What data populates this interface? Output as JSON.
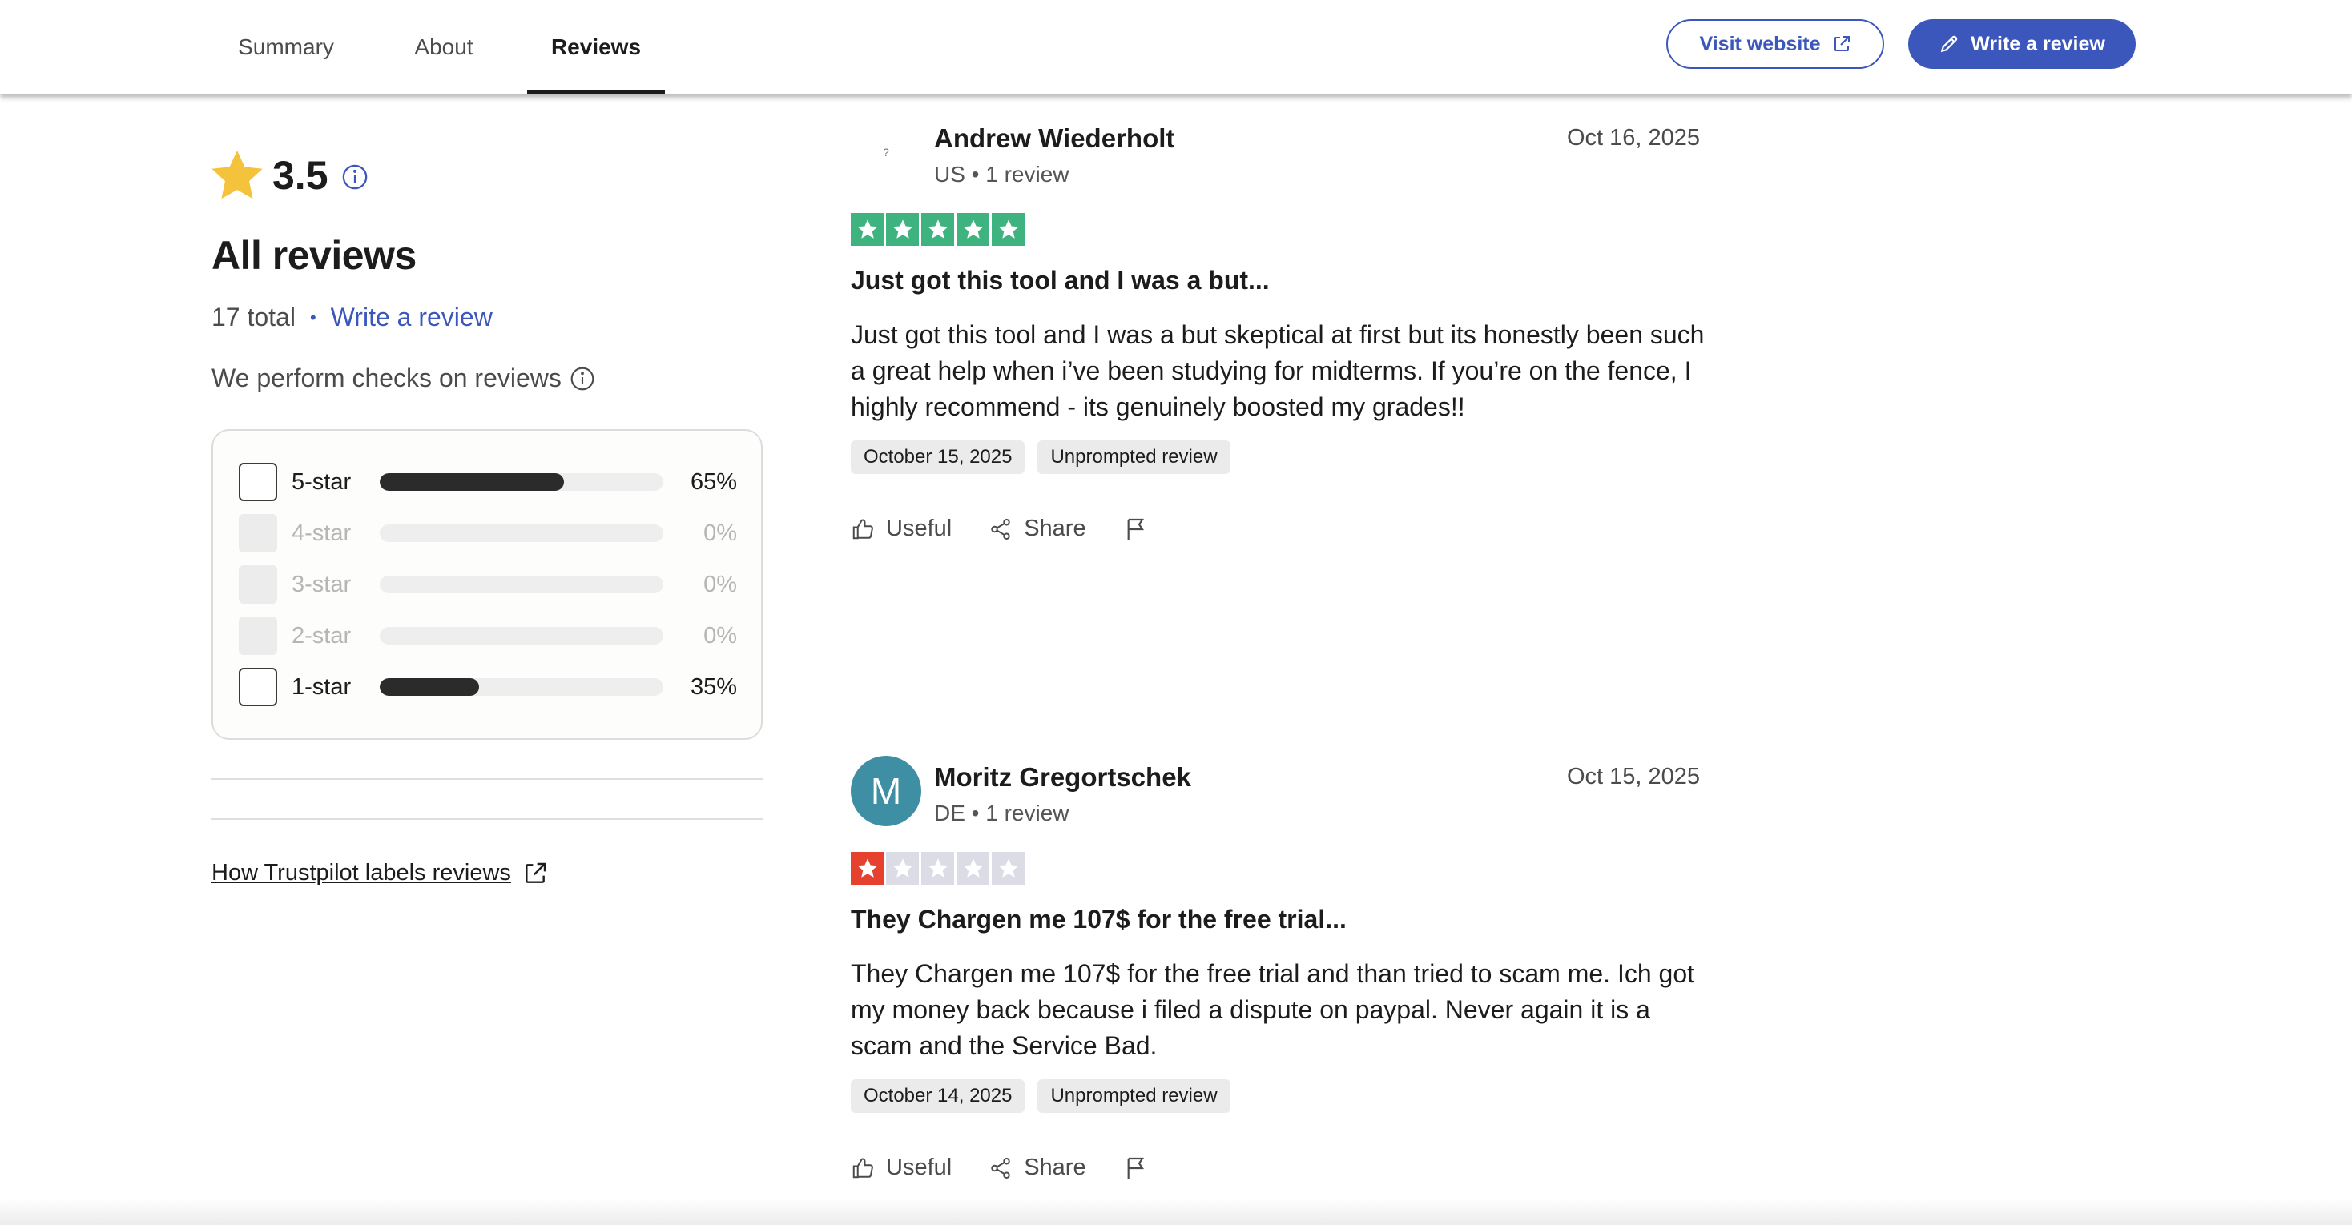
{
  "nav": {
    "tabs": [
      {
        "label": "Summary",
        "active": false
      },
      {
        "label": "About",
        "active": false
      },
      {
        "label": "Reviews",
        "active": true
      }
    ],
    "visit_website": "Visit website",
    "write_review": "Write a review"
  },
  "summary": {
    "rating": "3.5",
    "heading": "All reviews",
    "total": "17 total",
    "separator": "•",
    "write_review_link": "Write a review",
    "checks_text": "We perform checks on reviews",
    "filters": [
      {
        "label": "5-star",
        "percent": "65%",
        "fill": 0.65,
        "enabled": true
      },
      {
        "label": "4-star",
        "percent": "0%",
        "fill": 0,
        "enabled": false
      },
      {
        "label": "3-star",
        "percent": "0%",
        "fill": 0,
        "enabled": false
      },
      {
        "label": "2-star",
        "percent": "0%",
        "fill": 0,
        "enabled": false
      },
      {
        "label": "1-star",
        "percent": "35%",
        "fill": 0.35,
        "enabled": true
      }
    ],
    "labels_link": "How Trustpilot labels reviews"
  },
  "reviews": [
    {
      "name": "Andrew Wiederholt",
      "meta": "US • 1 review",
      "date": "Oct 16, 2025",
      "stars": 5,
      "avatar_letter": "",
      "avatar_color": "#ffffff",
      "title": "Just got this tool and I was a but...",
      "body": "Just got this tool and I was a but skeptical at first but its honestly been such a great help when i’ve been studying for midterms. If you’re on the fence, I highly recommend - its genuinely boosted my grades!!",
      "experience_date": "October 15, 2025",
      "label": "Unprompted review"
    },
    {
      "name": "Moritz Gregortschek",
      "meta": "DE • 1 review",
      "date": "Oct 15, 2025",
      "stars": 1,
      "avatar_letter": "M",
      "avatar_color": "#3e8fa3",
      "title": "They Chargen me 107$ for the free trial...",
      "body": "They Chargen me 107$ for the free trial and than tried to scam me. Ich got my money back because i filed a dispute on paypal. Never again it is a scam and the Service Bad.",
      "experience_date": "October 14, 2025",
      "label": "Unprompted review"
    }
  ],
  "actions": {
    "useful": "Useful",
    "share": "Share"
  },
  "colors": {
    "accent": "#3c57bc",
    "star_5": "#3fb37f",
    "star_1": "#e5412e",
    "star_empty": "#dcdce6",
    "summary_star": "#f5c33b"
  }
}
